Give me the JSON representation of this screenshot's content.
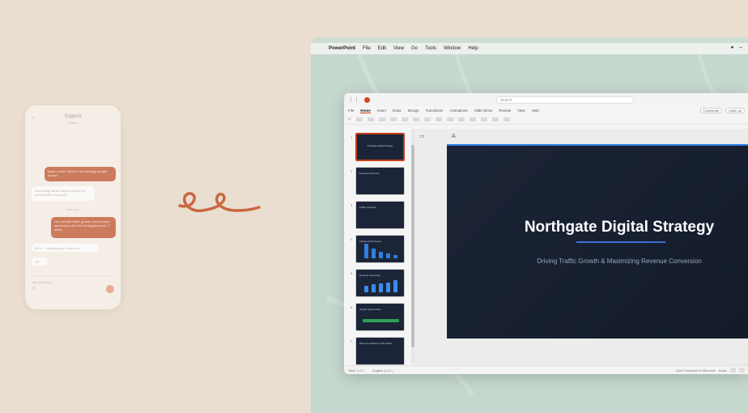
{
  "phone": {
    "back": "‹",
    "title": "Support",
    "subtitle": "Online",
    "messages": [
      {
        "dir": "out",
        "text": "Make a slide deck for our strategy update please"
      },
      {
        "dir": "in",
        "text": "Sure thing! Which topics should the presentation focus on?"
      },
      {
        "dir": "out",
        "text": "Our website traffic growth and revenue conversion with the Northgate brand, 7 slides"
      },
      {
        "dir": "in",
        "text": "On it — building your deck now"
      },
      {
        "dir": "in",
        "text": "OK"
      }
    ],
    "divider": "Just now",
    "input_placeholder": "Ask anything...",
    "plus": "+"
  },
  "mac_menu": {
    "app": "PowerPoint",
    "items": [
      "File",
      "Edit",
      "View",
      "Go",
      "Tools",
      "Window",
      "Help"
    ]
  },
  "ppt": {
    "search_placeholder": "Search",
    "tabs": [
      "File",
      "Home",
      "Insert",
      "Draw",
      "Design",
      "Transitions",
      "Animations",
      "Slide Show",
      "Review",
      "View",
      "Help"
    ],
    "active_tab": "Home",
    "comments_label": "Comments",
    "catchup_label": "Catch up",
    "thumbnails": [
      {
        "num": "1",
        "title": "Northgate Digital Strategy"
      },
      {
        "num": "2",
        "title": "Executive Summary"
      },
      {
        "num": "3",
        "title": "Traffic Overview"
      },
      {
        "num": "4",
        "title": "Channel Performance"
      },
      {
        "num": "5",
        "title": "Revenue Conversion"
      },
      {
        "num": "6",
        "title": "Growth Opportunities"
      },
      {
        "num": "7",
        "title": "Recommendations & Next Steps"
      }
    ],
    "slide": {
      "title": "Northgate Digital Strategy",
      "subtitle": "Driving Traffic Growth & Maximizing Revenue Conversion"
    },
    "status": {
      "slide_count": "Slide 1 of 7",
      "language": "English (U.S.)",
      "feedback": "Give Feedback to Microsoft",
      "notes": "Notes"
    },
    "bars_slide4": [
      0.9,
      0.6,
      0.4,
      0.3,
      0.2
    ],
    "bars_slide5": [
      0.4,
      0.5,
      0.55,
      0.6,
      0.75
    ]
  },
  "colors": {
    "accent": "#c43e1c",
    "slide_bg": "#1b2436",
    "slide_line": "#3a72d6",
    "phone_out": "#c96a4a"
  }
}
